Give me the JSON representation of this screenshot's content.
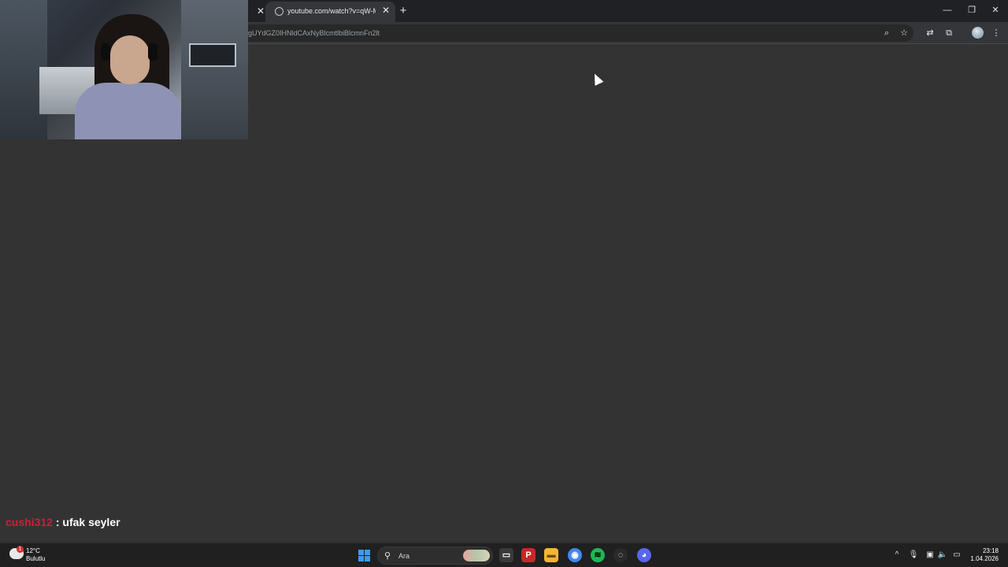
{
  "browser": {
    "tab": {
      "title": "youtube.com/watch?v=qW-ME",
      "close_glyph": "✕",
      "favicon": "loading-globe-icon"
    },
    "prev_tab_close_glyph": "✕",
    "new_tab_glyph": "+",
    "window_controls": {
      "minimize": "—",
      "restore": "❐",
      "close": "✕"
    },
    "address_bar": {
      "url": "gUYdGZ0IHNldCAxNyBlcmtlbiBlcmnFn2lt"
    },
    "toolbar_icons": {
      "zoom": "⌕",
      "bookmark": "☆",
      "translate": "⇄",
      "extensions": "⧉",
      "menu": "⋮"
    }
  },
  "stream_overlay": {
    "chat": {
      "username": "cushi312",
      "separator": " : ",
      "message": "ufak seyler"
    }
  },
  "taskbar": {
    "weather": {
      "temperature": "12°C",
      "condition": "Bulutlu",
      "badge": "1"
    },
    "search": {
      "glyph": "⚲",
      "label": "Ara"
    },
    "apps": [
      {
        "name": "task-view",
        "glyph": "▭",
        "color": "#3a3a3a"
      },
      {
        "name": "pandora",
        "glyph": "P",
        "color": "#c62828"
      },
      {
        "name": "file-explorer",
        "glyph": "▬",
        "color": "#f2b632"
      },
      {
        "name": "chrome",
        "glyph": "◉",
        "color": "#4285f4"
      },
      {
        "name": "spotify",
        "glyph": "≋",
        "color": "#1db954"
      },
      {
        "name": "steam",
        "glyph": "◌",
        "color": "#2a2a2a"
      },
      {
        "name": "discord",
        "glyph": "◕",
        "color": "#5865f2"
      }
    ],
    "tray": {
      "chevron": "^",
      "mic": "🎙",
      "network": "▣",
      "volume": "🔈",
      "battery": "▭"
    },
    "clock": {
      "time": "23:18",
      "date": "1.04.2026"
    }
  }
}
